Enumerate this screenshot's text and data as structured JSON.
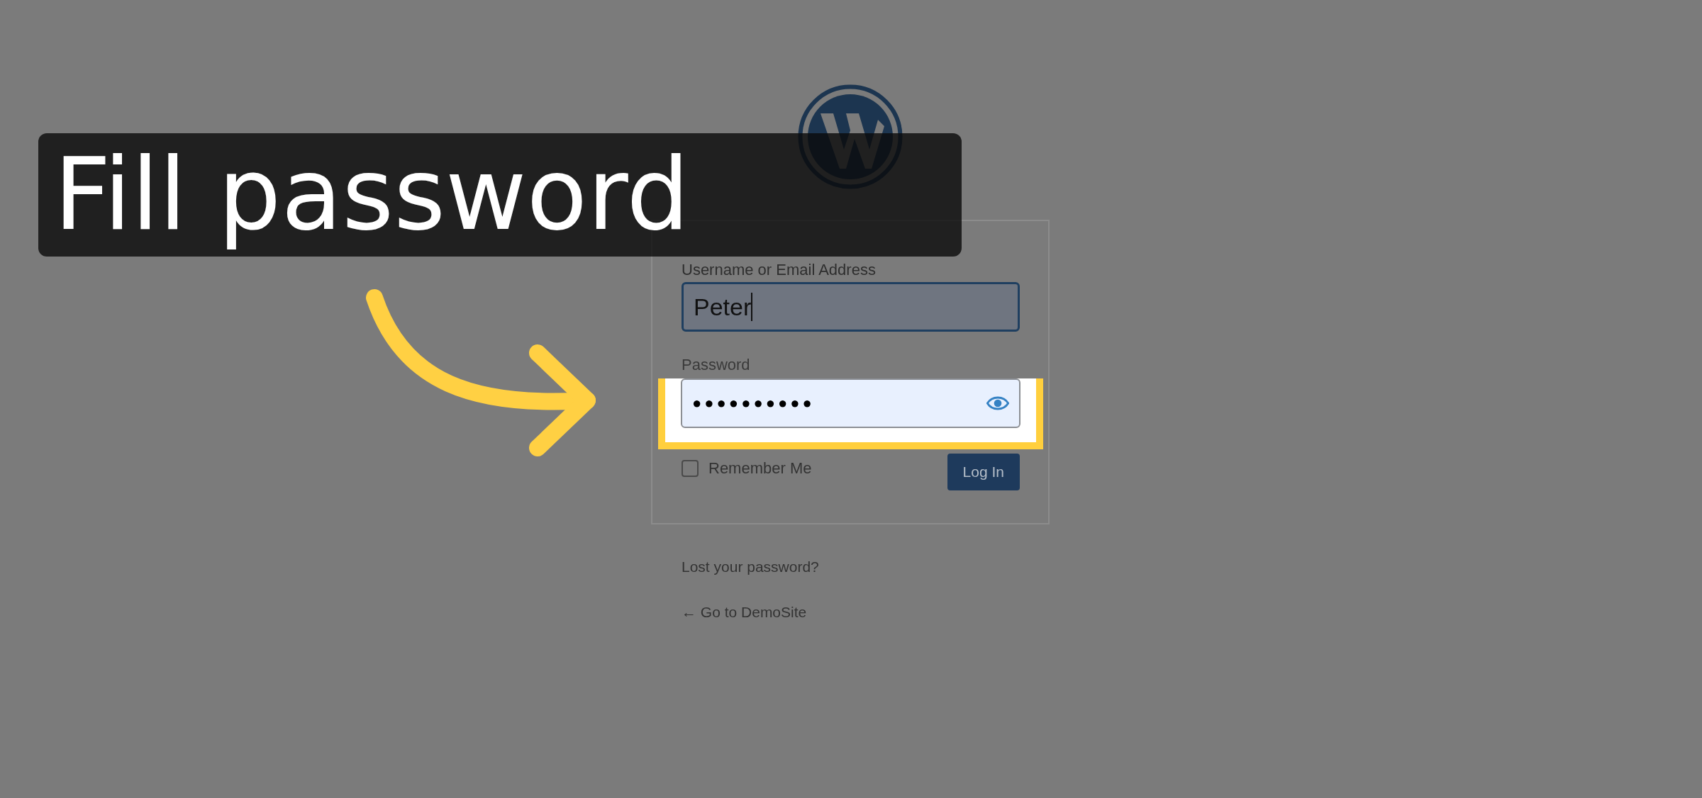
{
  "tutorial": {
    "caption": "Fill password"
  },
  "login": {
    "username_label": "Username or Email Address",
    "username_value": "Peter",
    "password_label": "Password",
    "password_value": "●●●●●●●●●●",
    "password_highlighted": true,
    "remember_label": "Remember Me",
    "remember_checked": false,
    "button": "Log In"
  },
  "links": [
    "Lost your password?",
    "← Go to DemoSite"
  ]
}
